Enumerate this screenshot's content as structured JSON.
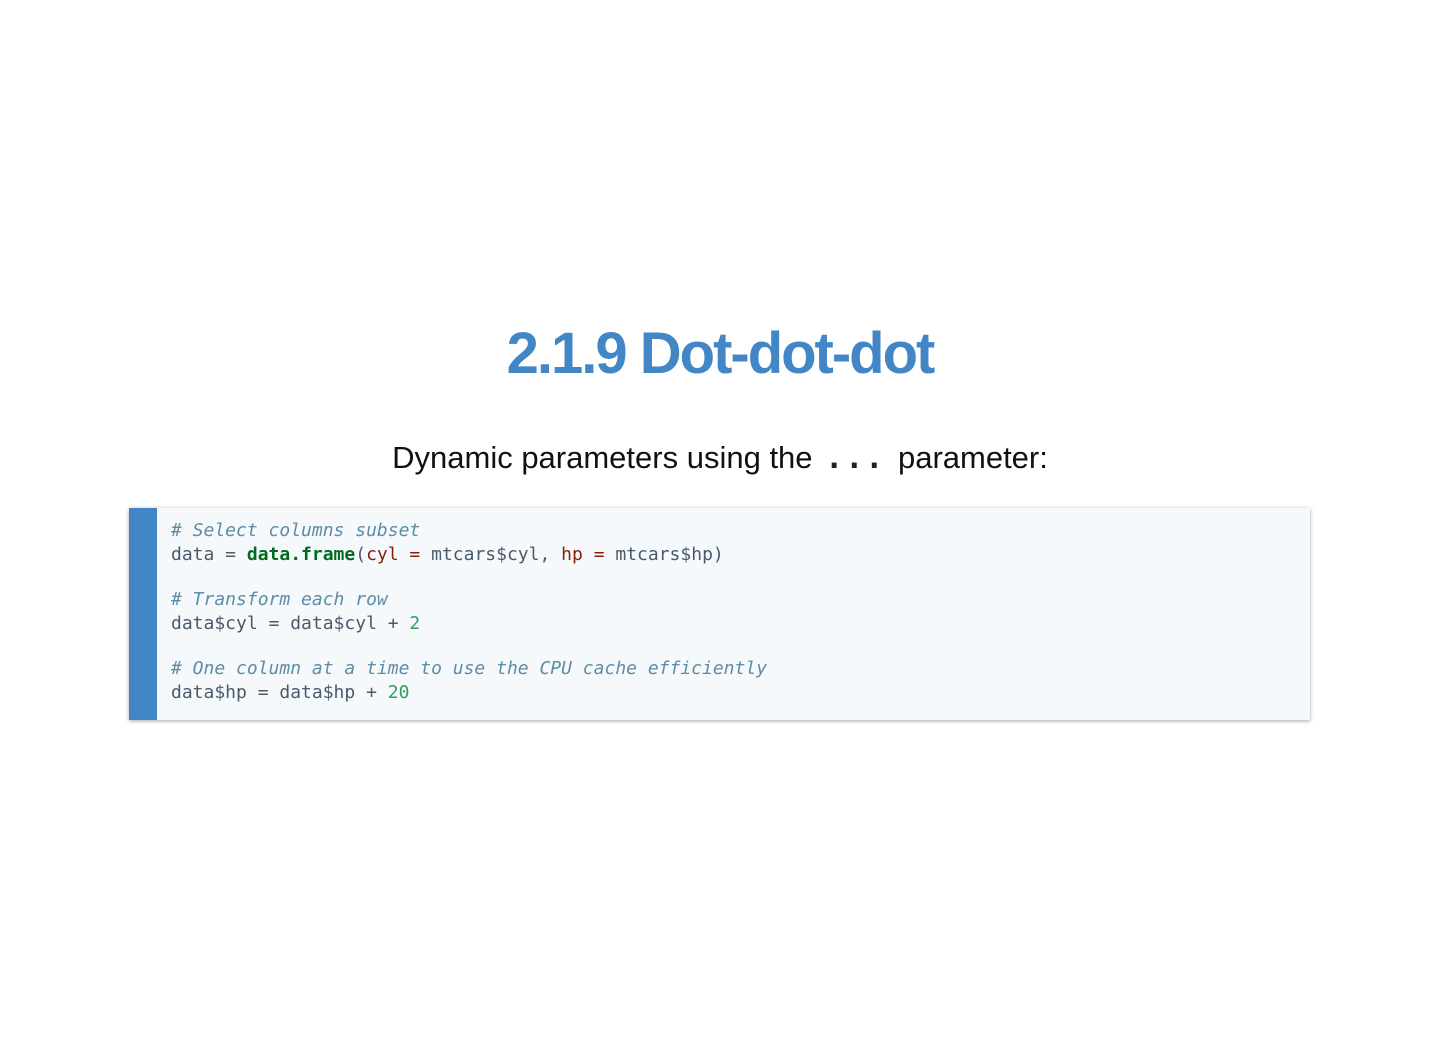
{
  "title": "2.1.9 Dot-dot-dot",
  "intro": {
    "before": "Dynamic parameters using the ",
    "code": "...",
    "after": " parameter:"
  },
  "code": {
    "line1_comment": "# Select columns subset",
    "line2": {
      "lhs": "data = ",
      "func": "data.frame",
      "open": "(",
      "arg1": "cyl",
      "eq1": " = ",
      "val1": "mtcars$cyl",
      "comma": ", ",
      "arg2": "hp",
      "eq2": " = ",
      "val2": "mtcars$hp",
      "close": ")"
    },
    "line4_comment": "# Transform each row",
    "line5": {
      "expr": "data$cyl = data$cyl + ",
      "num": "2"
    },
    "line7_comment": "# One column at a time to use the CPU cache efficiently",
    "line8": {
      "expr": "data$hp = data$hp + ",
      "num": "20"
    }
  },
  "colors": {
    "accent": "#4286c6",
    "code_background": "#f5f9fc",
    "comment": "#5e8ca6",
    "function": "#006b1e",
    "argument": "#8a1d06",
    "number": "#30a060"
  }
}
